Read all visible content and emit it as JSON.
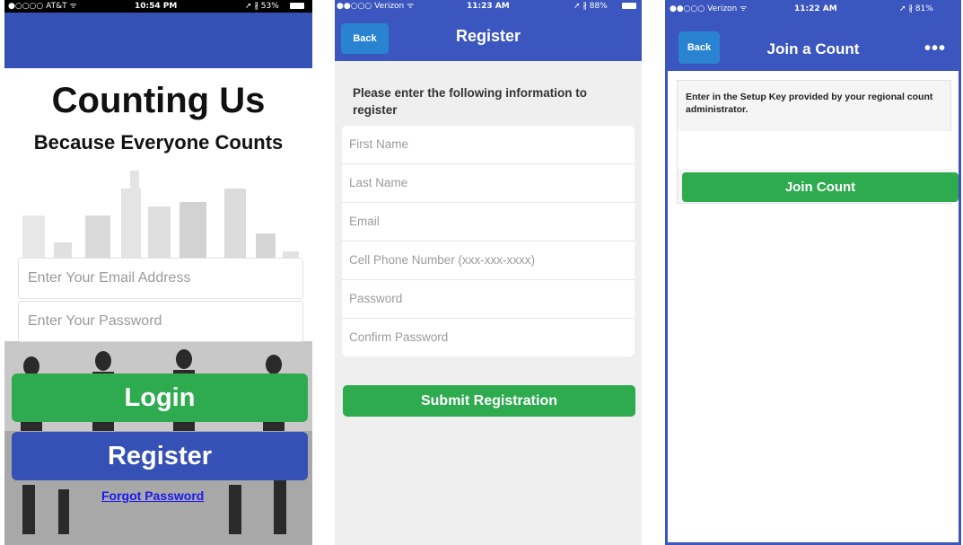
{
  "screen1": {
    "status": {
      "carrier": "●○○○○ AT&T ᯤ",
      "time": "10:54 PM",
      "battery": "➚ ∦ 53%"
    },
    "title": "Counting Us",
    "subtitle": "Because Everyone Counts",
    "email_placeholder": "Enter Your Email Address",
    "password_placeholder": "Enter Your Password",
    "login_label": "Login",
    "register_label": "Register",
    "forgot_label": "Forgot Password"
  },
  "screen2": {
    "status": {
      "carrier": "●●○○○ Verizon ᯤ",
      "time": "11:23 AM",
      "battery": "➚ ∦ 88%"
    },
    "back_label": "Back",
    "nav_title": "Register",
    "intro": "Please enter the following information to register",
    "fields": [
      {
        "placeholder": "First Name"
      },
      {
        "placeholder": "Last Name"
      },
      {
        "placeholder": "Email"
      },
      {
        "placeholder": "Cell Phone Number (xxx-xxx-xxxx)"
      },
      {
        "placeholder": "Password"
      },
      {
        "placeholder": "Confirm Password"
      }
    ],
    "submit_label": "Submit Registration"
  },
  "screen3": {
    "status": {
      "carrier": "●●○○○ Verizon ᯤ",
      "time": "11:22 AM",
      "battery": "➚ ∦ 81%"
    },
    "back_label": "Back",
    "nav_title": "Join a Count",
    "more_label": "•••",
    "prompt": "Enter in the Setup Key provided by your regional count administrator.",
    "setup_key_value": "",
    "join_label": "Join Count"
  },
  "colors": {
    "brand_blue": "#3551b5",
    "action_green": "#2eaa4f",
    "back_button_blue": "#2a83d0"
  }
}
